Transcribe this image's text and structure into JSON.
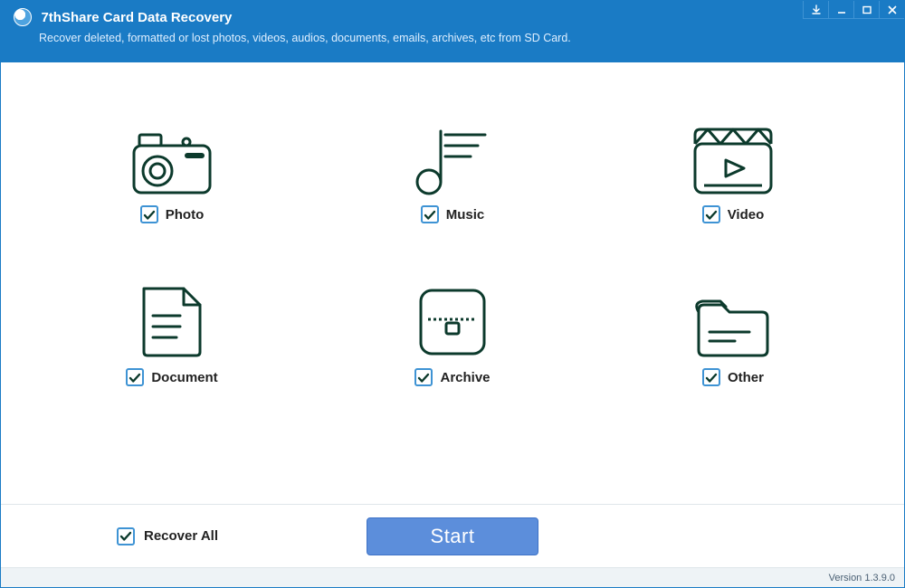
{
  "window": {
    "title": "7thShare Card Data Recovery",
    "subtitle": "Recover deleted, formatted or lost photos, videos, audios, documents, emails, archives, etc from SD Card."
  },
  "categories": [
    {
      "id": "photo",
      "label": "Photo",
      "checked": true
    },
    {
      "id": "music",
      "label": "Music",
      "checked": true
    },
    {
      "id": "video",
      "label": "Video",
      "checked": true
    },
    {
      "id": "document",
      "label": "Document",
      "checked": true
    },
    {
      "id": "archive",
      "label": "Archive",
      "checked": true
    },
    {
      "id": "other",
      "label": "Other",
      "checked": true
    }
  ],
  "recover_all": {
    "label": "Recover All",
    "checked": true
  },
  "start_button": {
    "label": "Start"
  },
  "version": {
    "label": "Version 1.3.9.0"
  },
  "colors": {
    "accent": "#1a7bc5",
    "button": "#5c8edb",
    "stroke": "#0c3a2c"
  }
}
